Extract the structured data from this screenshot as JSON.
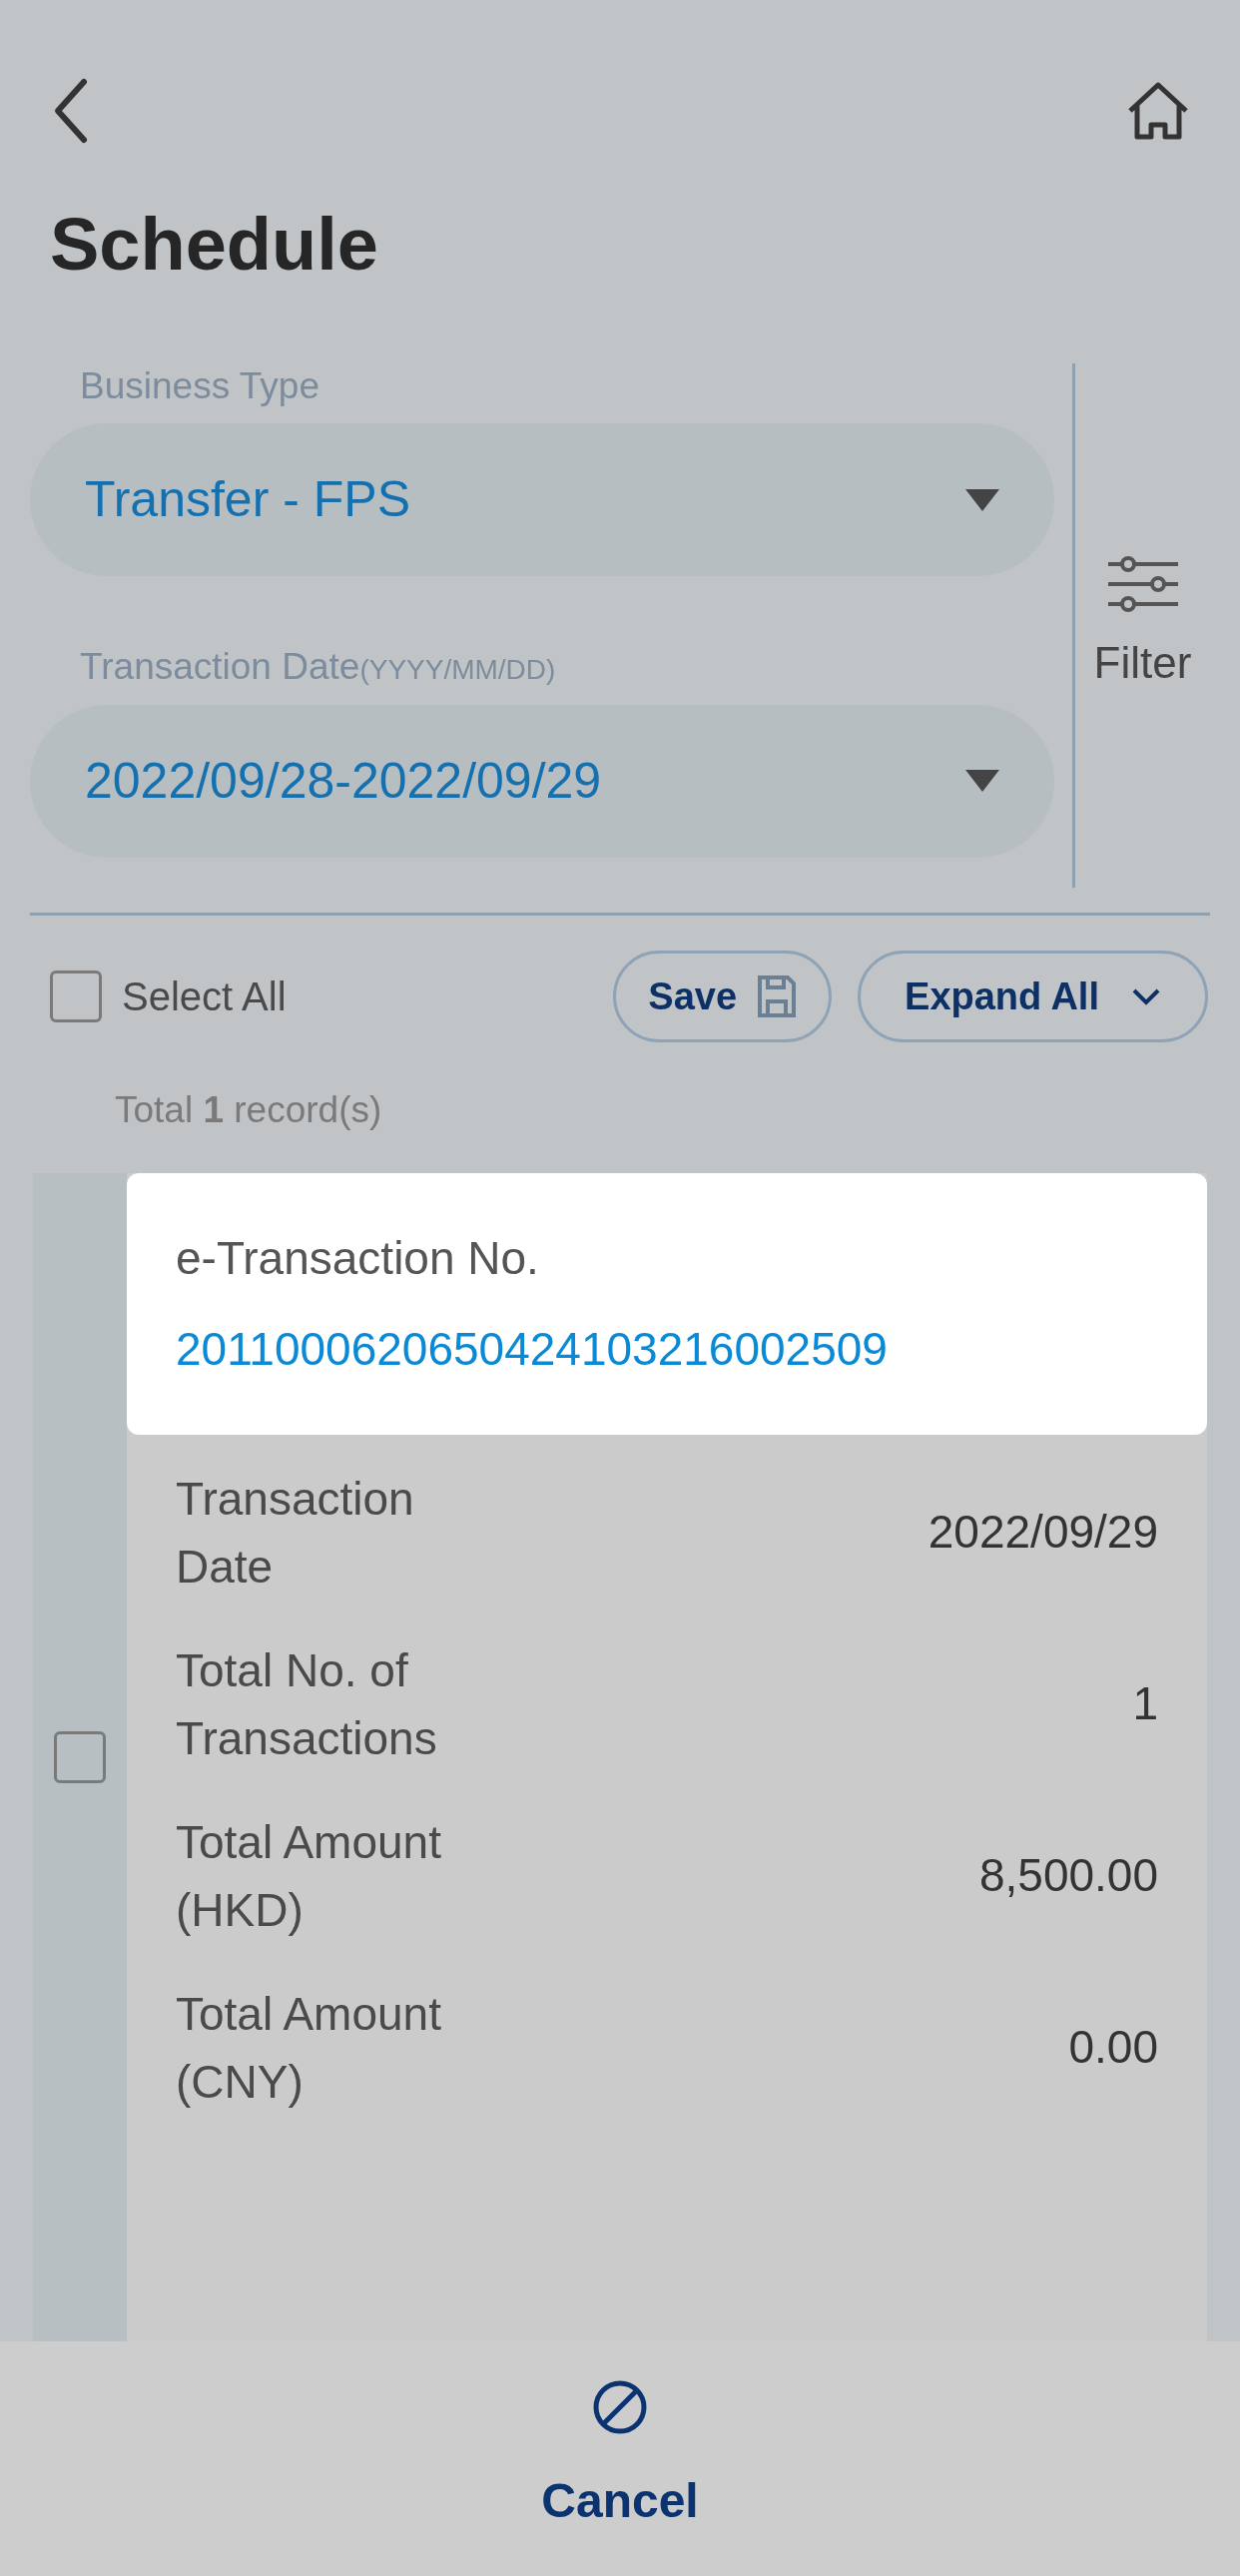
{
  "header": {
    "title": "Schedule"
  },
  "filters": [
    {
      "label": "Business Type",
      "value": "Transfer - FPS"
    },
    {
      "label": "Transaction Date",
      "hint": "(YYYY/MM/DD)",
      "value": "2022/09/28-2022/09/29"
    }
  ],
  "filter_button": {
    "label": "Filter"
  },
  "toolbar": {
    "select_all": {
      "label": "Select All",
      "checked": false
    },
    "save": "Save",
    "expand_all": "Expand All"
  },
  "total": "Total **1** record(s)",
  "records": [
    {
      "checked": false,
      "highlight": {
        "label": "e-Transaction No.",
        "value": "2011000620650424103216002509"
      },
      "fields": [
        {
          "label": "Transaction Date",
          "value": "2022/09/29"
        },
        {
          "label": "Total No. of Transactions",
          "value": "1"
        },
        {
          "label": "Total Amount(HKD)",
          "value": "8,500.00"
        },
        {
          "label": "Total Amount(CNY)",
          "value": "0.00"
        }
      ]
    }
  ],
  "footer": {
    "cancel": "Cancel"
  }
}
